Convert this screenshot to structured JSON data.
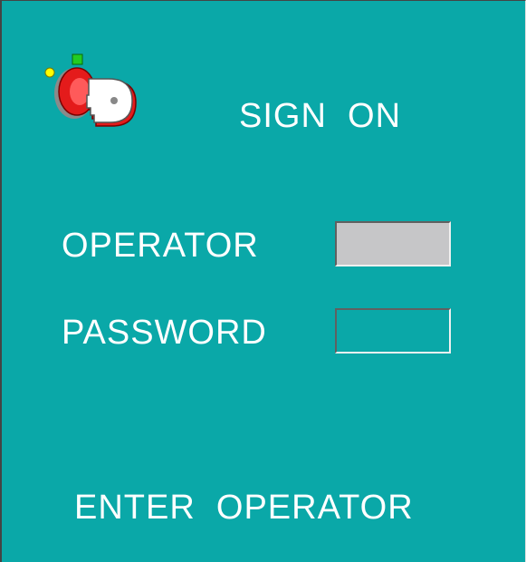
{
  "screen": {
    "title": "SIGN  ON",
    "icon": "key-in-lock-icon",
    "background_color": "#0aa8a8"
  },
  "form": {
    "operator_label": "OPERATOR",
    "operator_value": "",
    "password_label": "PASSWORD",
    "password_value": ""
  },
  "status": {
    "message": "ENTER  OPERATOR"
  }
}
